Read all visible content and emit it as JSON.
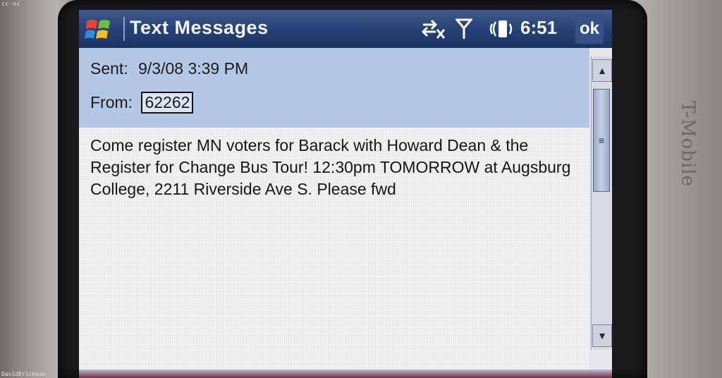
{
  "watermark": {
    "license": "cc-nc",
    "author": "DavidErickson"
  },
  "device": {
    "brand": "T-Mobile",
    "brand_mark": "T"
  },
  "titlebar": {
    "title": "Text Messages",
    "clock": "6:51",
    "ok_label": "ok",
    "start_icon": "windows-flag-icon",
    "connectivity_icon": "connectivity-off-icon",
    "signal_icon": "signal-antenna-icon",
    "volume_icon": "vibrate-volume-icon"
  },
  "message": {
    "sent_label": "Sent:",
    "sent_value": "9/3/08 3:39 PM",
    "from_label": "From:",
    "from_value": "62262",
    "body": "Come register MN voters for Barack with Howard Dean & the Register for Change Bus Tour! 12:30pm TOMORROW at Augsburg College, 2211 Riverside Ave S. Please fwd"
  },
  "scrollbar": {
    "up_icon": "scroll-up-arrow-icon",
    "down_icon": "scroll-down-arrow-icon",
    "thumb_grip": "≡"
  },
  "colors": {
    "titlebar": "#243f73",
    "header_panel": "#b4c8e6",
    "body": "#f4f4f7",
    "brand_t": "#b3243b"
  }
}
